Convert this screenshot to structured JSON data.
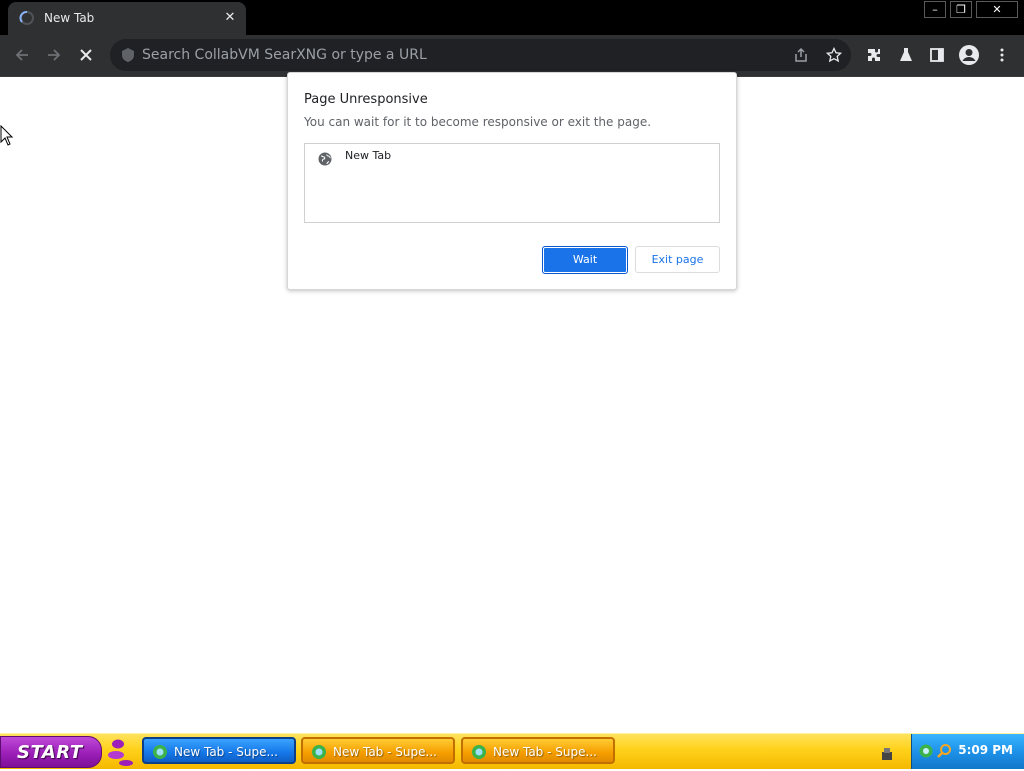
{
  "browser": {
    "tab": {
      "title": "New Tab"
    },
    "window_controls": {
      "minimize": "–",
      "restore": "❐",
      "close": "✕"
    },
    "omnibox": {
      "placeholder": "Search CollabVM SearXNG or type a URL"
    }
  },
  "dialog": {
    "title": "Page Unresponsive",
    "subtitle": "You can wait for it to become responsive or exit the page.",
    "pages": [
      {
        "label": "New Tab"
      }
    ],
    "wait_label": "Wait",
    "exit_label": "Exit page"
  },
  "taskbar": {
    "start_label": "START",
    "tasks": [
      {
        "label": "New Tab - Supe...",
        "active": true
      },
      {
        "label": "New Tab - Supe...",
        "active": false
      },
      {
        "label": "New Tab - Supe...",
        "active": false
      }
    ],
    "clock": "5:09 PM"
  },
  "colors": {
    "accent": "#1a73e8",
    "toolbar": "#2f3032",
    "taskbar": "#ffd11a",
    "start_button": "#9b1fb8",
    "tray": "#1c8fe6"
  }
}
